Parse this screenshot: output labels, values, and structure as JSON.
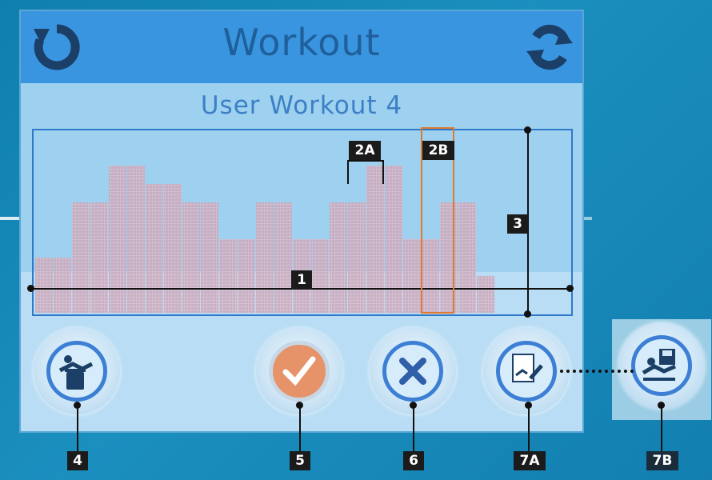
{
  "header": {
    "title": "Workout",
    "back_icon": "back-icon",
    "refresh_icon": "refresh-icon"
  },
  "subtitle": "User Workout  4",
  "profile": {
    "segment_levels": [
      3,
      3,
      6,
      6,
      8,
      8,
      7,
      7,
      6,
      6,
      4,
      4,
      6,
      6,
      4,
      4,
      6,
      6,
      8,
      8,
      4,
      4,
      6,
      6,
      2
    ],
    "selected_segment": 13,
    "colors": {
      "bar": "#c8a8b8",
      "grid": "#e9c9d9"
    }
  },
  "buttons": {
    "delete": {
      "icon": "delete-user-icon"
    },
    "accept": {
      "icon": "checkmark-icon"
    },
    "cancel": {
      "icon": "cancel-x-icon"
    },
    "edit": {
      "icon": "edit-workout-icon"
    },
    "save": {
      "icon": "save-workout-icon"
    }
  },
  "callouts": {
    "c1": "1",
    "c2a": "2A",
    "c2b": "2B",
    "c3": "3",
    "c4": "4",
    "c5": "5",
    "c6": "6",
    "c7a": "7A",
    "c7b": "7B"
  }
}
